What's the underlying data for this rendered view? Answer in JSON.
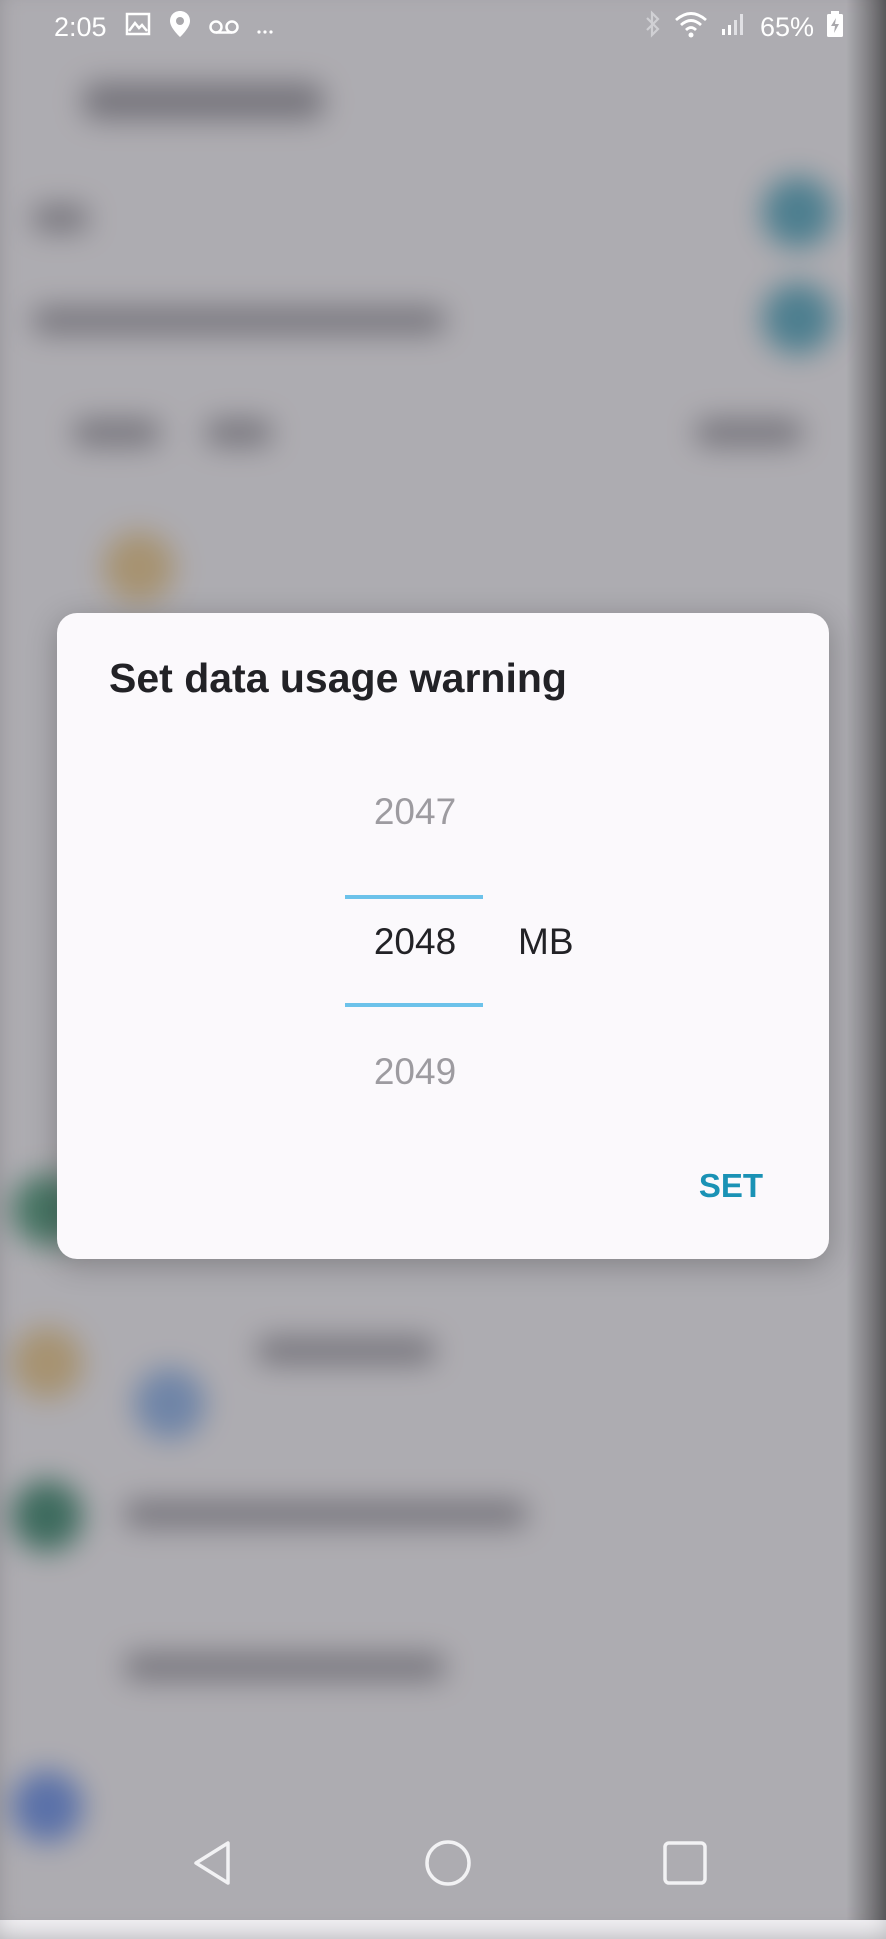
{
  "status_bar": {
    "time": "2:05",
    "battery": "65%",
    "icons_left": [
      "image-icon",
      "location-icon",
      "voicemail-icon",
      "more-icon"
    ],
    "icons_right": [
      "bluetooth-icon",
      "wifi-icon",
      "signal-icon",
      "battery-icon"
    ]
  },
  "dialog": {
    "title": "Set data usage warning",
    "picker": {
      "previous": "2047",
      "current": "2048",
      "next": "2049"
    },
    "unit": "MB",
    "set_label": "SET"
  },
  "nav_bar": {
    "buttons": [
      "back-icon",
      "home-icon",
      "recents-icon"
    ]
  },
  "colors": {
    "accent": "#1a92b5",
    "picker_line": "#6cc2ea",
    "dialog_bg": "#fbf9fc",
    "text": "#222226",
    "muted_text": "#9d9ba0"
  }
}
